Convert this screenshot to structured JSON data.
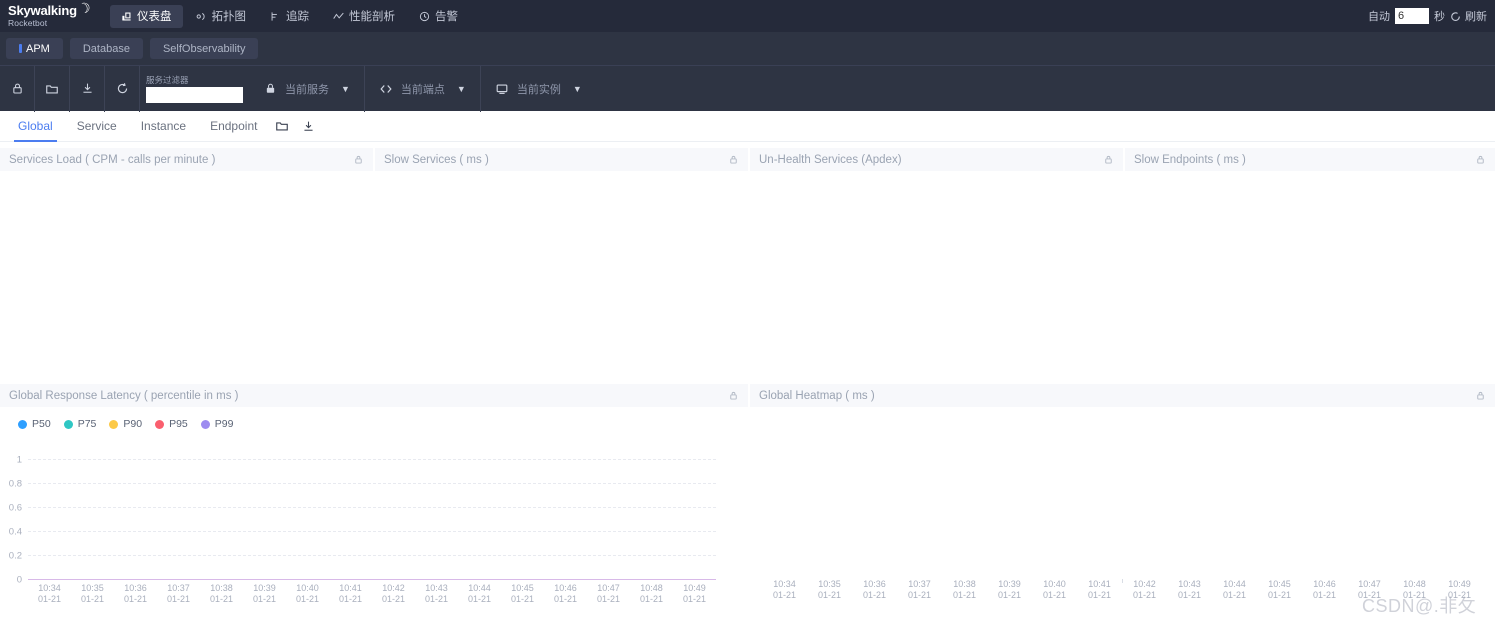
{
  "header": {
    "brand": "Skywalking",
    "brand_sub": "Rocketbot",
    "nav": [
      {
        "label": "仪表盘",
        "icon": "dashboard-icon",
        "active": true
      },
      {
        "label": "拓扑图",
        "icon": "topology-icon",
        "active": false
      },
      {
        "label": "追踪",
        "icon": "trace-icon",
        "active": false
      },
      {
        "label": "性能剖析",
        "icon": "profile-icon",
        "active": false
      },
      {
        "label": "告警",
        "icon": "alarm-icon",
        "active": false
      }
    ],
    "auto_label": "自动",
    "interval_value": "6",
    "unit_label": "秒",
    "refresh_label": "刷新",
    "refresh_icon": "refresh-circle-icon"
  },
  "tabs": [
    {
      "label": "APM",
      "active": true
    },
    {
      "label": "Database",
      "active": false
    },
    {
      "label": "SelfObservability",
      "active": false
    }
  ],
  "toolbar": {
    "icons": [
      "lock-icon",
      "folder-icon",
      "download-icon",
      "sync-icon"
    ],
    "filter_label": "服务过滤器",
    "filter_value": "",
    "filter_placeholder": "",
    "selectors": [
      {
        "label": "当前服务",
        "icon": "lock-icon"
      },
      {
        "label": "当前端点",
        "icon": "code-icon"
      },
      {
        "label": "当前实例",
        "icon": "monitor-icon"
      }
    ]
  },
  "subtabs": {
    "items": [
      {
        "label": "Global",
        "active": true
      },
      {
        "label": "Service",
        "active": false
      },
      {
        "label": "Instance",
        "active": false
      },
      {
        "label": "Endpoint",
        "active": false
      }
    ],
    "icons": [
      "folder-icon",
      "download-icon"
    ]
  },
  "cards_top": [
    {
      "title": "Services Load ( CPM - calls per minute )",
      "lock": "lock-icon"
    },
    {
      "title": "Slow Services ( ms )",
      "lock": "lock-icon"
    },
    {
      "title": "Un-Health Services (Apdex)",
      "lock": "lock-icon"
    },
    {
      "title": "Slow Endpoints ( ms )",
      "lock": "lock-icon"
    }
  ],
  "cards_bottom": [
    {
      "title": "Global Response Latency ( percentile in ms )",
      "lock": "lock-icon"
    },
    {
      "title": "Global Heatmap ( ms )",
      "lock": "lock-icon"
    }
  ],
  "colors": {
    "p50": "#2e9fff",
    "p75": "#2fc7c4",
    "p90": "#fcc947",
    "p95": "#fa5f6e",
    "p99": "#9d8cf0",
    "accent": "#4c7df0",
    "topbar_bg": "#252a3a",
    "tabbar_bg": "#2e3443",
    "card_head_bg": "#f7f8fb"
  },
  "watermark": "CSDN@.非攵",
  "chart_data": [
    {
      "type": "line",
      "title": "Global Response Latency ( percentile in ms )",
      "xlabel": "",
      "ylabel": "",
      "ylim": [
        0,
        1
      ],
      "yticks": [
        "0",
        "0.2",
        "0.4",
        "0.6",
        "0.8",
        "1"
      ],
      "grid": true,
      "legend": [
        "P50",
        "P75",
        "P90",
        "P95",
        "P99"
      ],
      "legend_position": "top-left",
      "x": [
        "10:34\n01-21",
        "10:35\n01-21",
        "10:36\n01-21",
        "10:37\n01-21",
        "10:38\n01-21",
        "10:39\n01-21",
        "10:40\n01-21",
        "10:41\n01-21",
        "10:42\n01-21",
        "10:43\n01-21",
        "10:44\n01-21",
        "10:45\n01-21",
        "10:46\n01-21",
        "10:47\n01-21",
        "10:48\n01-21",
        "10:49\n01-21"
      ],
      "series": [
        {
          "name": "P50",
          "color": "#2e9fff",
          "values": [
            0,
            0,
            0,
            0,
            0,
            0,
            0,
            0,
            0,
            0,
            0,
            0,
            0,
            0,
            0,
            0
          ]
        },
        {
          "name": "P75",
          "color": "#2fc7c4",
          "values": [
            0,
            0,
            0,
            0,
            0,
            0,
            0,
            0,
            0,
            0,
            0,
            0,
            0,
            0,
            0,
            0
          ]
        },
        {
          "name": "P90",
          "color": "#fcc947",
          "values": [
            0,
            0,
            0,
            0,
            0,
            0,
            0,
            0,
            0,
            0,
            0,
            0,
            0,
            0,
            0,
            0
          ]
        },
        {
          "name": "P95",
          "color": "#fa5f6e",
          "values": [
            0,
            0,
            0,
            0,
            0,
            0,
            0,
            0,
            0,
            0,
            0,
            0,
            0,
            0,
            0,
            0
          ]
        },
        {
          "name": "P99",
          "color": "#9d8cf0",
          "values": [
            0,
            0,
            0,
            0,
            0,
            0,
            0,
            0,
            0,
            0,
            0,
            0,
            0,
            0,
            0,
            0
          ]
        }
      ]
    },
    {
      "type": "heatmap",
      "title": "Global Heatmap ( ms )",
      "xlabel": "",
      "ylabel": "",
      "grid": false,
      "x": [
        "10:34\n01-21",
        "10:35\n01-21",
        "10:36\n01-21",
        "10:37\n01-21",
        "10:38\n01-21",
        "10:39\n01-21",
        "10:40\n01-21",
        "10:41\n01-21",
        "10:42\n01-21",
        "10:43\n01-21",
        "10:44\n01-21",
        "10:45\n01-21",
        "10:46\n01-21",
        "10:47\n01-21",
        "10:48\n01-21",
        "10:49\n01-21"
      ],
      "y": [],
      "values": []
    }
  ]
}
